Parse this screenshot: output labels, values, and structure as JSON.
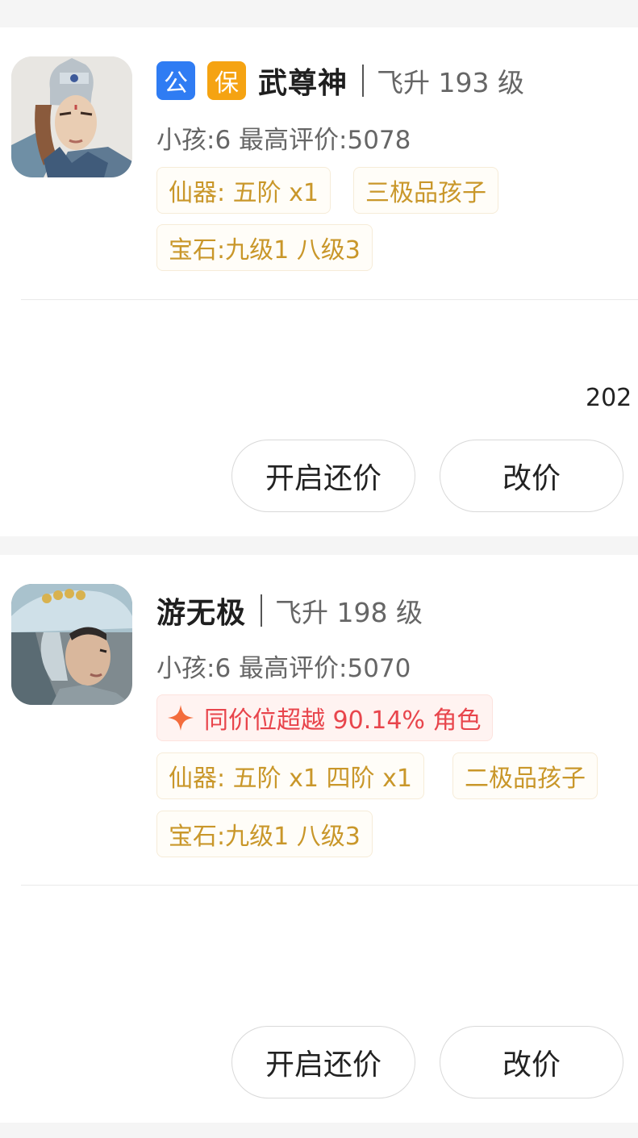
{
  "listings": [
    {
      "badges": [
        "公",
        "保"
      ],
      "name": "武尊神",
      "level": "飞升 193 级",
      "kids": "小孩:6",
      "rating": "最高评价:5078",
      "tags": [
        "仙器: 五阶 x1",
        "三极品孩子",
        "宝石:九级1 八级3"
      ],
      "truncated_text": "202",
      "buttons": {
        "counter_offer": "开启还价",
        "edit_price": "改价"
      }
    },
    {
      "name": "游无极",
      "level": "飞升 198 级",
      "kids": "小孩:6",
      "rating": "最高评价:5070",
      "highlight": "同价位超越 90.14% 角色",
      "tags": [
        "仙器: 五阶 x1 四阶 x1",
        "二极品孩子",
        "宝石:九级1 八级3"
      ],
      "buttons": {
        "counter_offer": "开启还价",
        "edit_price": "改价"
      }
    }
  ],
  "colors": {
    "official_badge": "#2f7cf3",
    "guarantee_badge": "#f5a312",
    "tag_text": "#c9972a",
    "highlight_text": "#e8454c"
  },
  "icons": {
    "avatar_1": "warrior-character-portrait",
    "avatar_2": "swordsman-character-portrait",
    "highlight": "sparkle-icon"
  }
}
